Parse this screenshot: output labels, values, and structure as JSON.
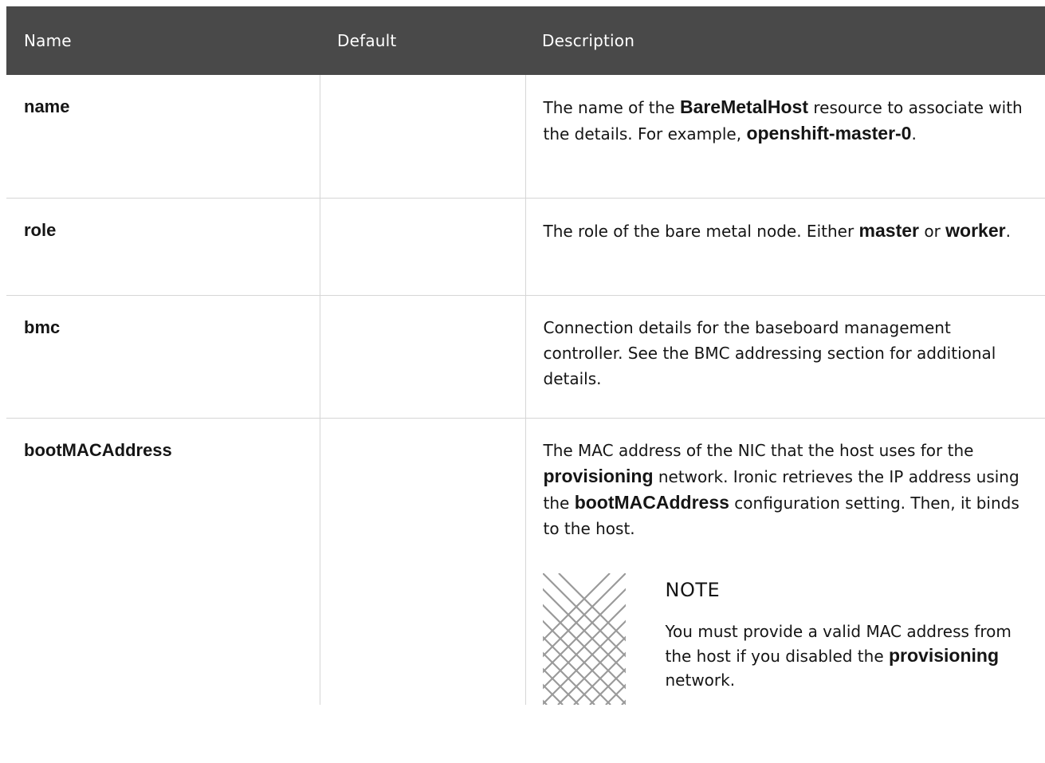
{
  "header": {
    "name": "Name",
    "default": "Default",
    "description": "Description"
  },
  "rows": [
    {
      "name": "name",
      "default": "",
      "desc": {
        "t1": "The name of the ",
        "b1": "BareMetalHost",
        "t2": " resource to associate with the details. For example, ",
        "b2": "openshift-master-0",
        "t3": "."
      }
    },
    {
      "name": "role",
      "default": "",
      "desc": {
        "t1": "The role of the bare metal node. Either ",
        "b1": "master",
        "t2": " or ",
        "b2": "worker",
        "t3": "."
      }
    },
    {
      "name": "bmc",
      "default": "",
      "desc": {
        "t1": "Connection details for the baseboard management controller. See the BMC addressing section for additional details."
      }
    },
    {
      "name": "bootMACAddress",
      "default": "",
      "desc": {
        "t1": "The MAC address of the NIC that the host uses for the ",
        "b1": "provisioning",
        "t2": " network. Ironic retrieves the IP address using the ",
        "b2": "bootMACAddress",
        "t3": " configuration setting. Then, it binds to the host."
      },
      "note": {
        "title": "NOTE",
        "t1": "You must provide a valid MAC address from the host if you disabled the ",
        "b1": "provisioning",
        "t2": " network."
      }
    }
  ],
  "colors": {
    "header_bg": "#494949",
    "border": "#d6d6d6",
    "text": "#151515"
  },
  "icons": {
    "note": "note-lattice-icon"
  }
}
